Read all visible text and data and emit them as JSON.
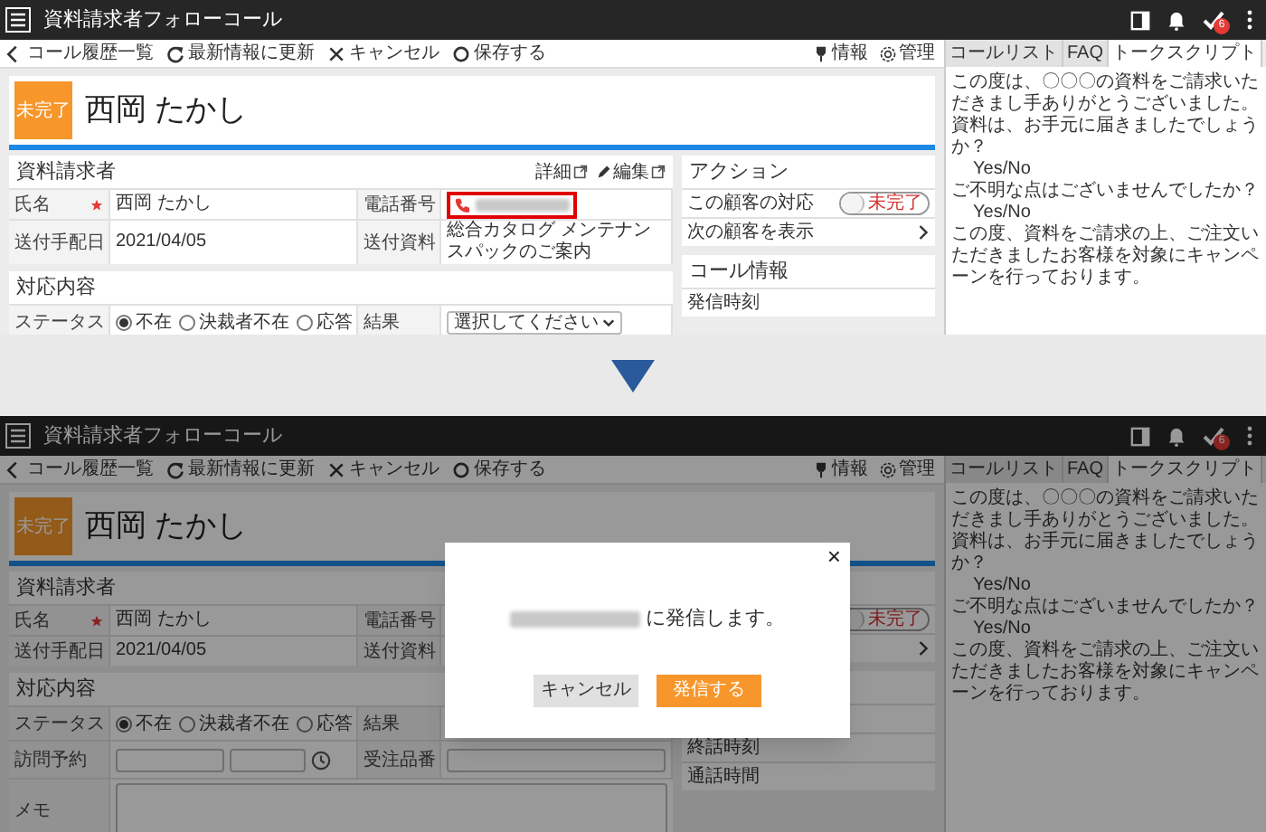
{
  "screens": [
    {
      "dimmed": false,
      "app_bar": {
        "title": "資料請求者フォローコール",
        "badge": "6"
      },
      "toolbar": [
        {
          "kind": "back",
          "label": "コール履歴一覧"
        },
        {
          "kind": "refresh",
          "label": "最新情報に更新"
        },
        {
          "kind": "cancel",
          "label": "キャンセル"
        },
        {
          "kind": "save",
          "label": "保存する"
        }
      ],
      "toolbar_links": [
        {
          "kind": "info",
          "label": "情報"
        },
        {
          "kind": "manage",
          "label": "管理"
        }
      ],
      "tabs": [
        {
          "label": "コールリスト",
          "selected": false
        },
        {
          "label": "FAQ",
          "selected": false
        },
        {
          "label": "トークスクリプト",
          "selected": true
        }
      ],
      "script": [
        {
          "text": "この度は、〇〇〇の資料をご請求いただきまし手ありがとうございました。",
          "indent": false
        },
        {
          "text": "資料は、お手元に届きましたでしょうか？",
          "indent": false
        },
        {
          "text": "Yes/No",
          "indent": true
        },
        {
          "text": "ご不明な点はございませんでしたか？",
          "indent": false
        },
        {
          "text": "Yes/No",
          "indent": true
        },
        {
          "text": "この度、資料をご請求の上、ご注文いただきましたお客様を対象にキャンペーンを行っております。",
          "indent": false
        }
      ],
      "header": {
        "status": "未完了",
        "name": "西岡 たかし"
      },
      "requester": {
        "title": "資料請求者",
        "links": [
          {
            "kind": "detail",
            "label": "詳細"
          },
          {
            "kind": "edit",
            "label": "編集"
          }
        ],
        "rows": [
          {
            "label": "氏名",
            "required": true,
            "value": "西岡 たかし",
            "label_2": "電話番号",
            "value_2": {
              "kind": "phone",
              "highlighted": true
            }
          },
          {
            "label": "送付手配日",
            "required": false,
            "value": "2021/04/05",
            "label_2": "送付資料",
            "value_2": {
              "kind": "text",
              "text": "総合カタログ メンテナンスパックのご案内"
            }
          }
        ]
      },
      "response": {
        "title": "対応内容",
        "rows": [
          {
            "kind": "status",
            "label": "ステータス",
            "options": [
              {
                "label": "不在",
                "selected": true
              },
              {
                "label": "決裁者不在",
                "selected": false
              },
              {
                "label": "応答",
                "selected": false
              }
            ],
            "label_2": "結果",
            "value_2": {
              "kind": "select",
              "text": "選択してください"
            }
          }
        ]
      },
      "action": {
        "title": "アクション",
        "rows": [
          {
            "kind": "toggle",
            "label": "この顧客の対応",
            "on": false,
            "state_label": "未完了"
          },
          {
            "kind": "link",
            "label": "次の顧客を表示"
          }
        ]
      },
      "call_info": {
        "title": "コール情報",
        "rows": [
          {
            "label": "発信時刻"
          }
        ]
      }
    },
    {
      "dimmed": true,
      "app_bar": {
        "title": "資料請求者フォローコール",
        "badge": "6"
      },
      "toolbar": [
        {
          "kind": "back",
          "label": "コール履歴一覧"
        },
        {
          "kind": "refresh",
          "label": "最新情報に更新"
        },
        {
          "kind": "cancel",
          "label": "キャンセル"
        },
        {
          "kind": "save",
          "label": "保存する"
        }
      ],
      "toolbar_links": [
        {
          "kind": "info",
          "label": "情報"
        },
        {
          "kind": "manage",
          "label": "管理"
        }
      ],
      "tabs": [
        {
          "label": "コールリスト",
          "selected": false
        },
        {
          "label": "FAQ",
          "selected": false
        },
        {
          "label": "トークスクリプト",
          "selected": true
        }
      ],
      "script": [
        {
          "text": "この度は、〇〇〇の資料をご請求いただきまし手ありがとうございました。",
          "indent": false
        },
        {
          "text": "資料は、お手元に届きましたでしょうか？",
          "indent": false
        },
        {
          "text": "Yes/No",
          "indent": true
        },
        {
          "text": "ご不明な点はございませんでしたか？",
          "indent": false
        },
        {
          "text": "Yes/No",
          "indent": true
        },
        {
          "text": "この度、資料をご請求の上、ご注文いただきましたお客様を対象にキャンペーンを行っております。",
          "indent": false
        }
      ],
      "header": {
        "status": "未完了",
        "name": "西岡 たかし"
      },
      "requester": {
        "title": "資料請求者",
        "rows": [
          {
            "label": "氏名",
            "required": true,
            "value": "西岡 たかし",
            "label_2": "電話番号"
          },
          {
            "label": "送付手配日",
            "required": false,
            "value": "2021/04/05",
            "label_2": "送付資料"
          }
        ]
      },
      "response": {
        "title": "対応内容",
        "rows": [
          {
            "kind": "status",
            "label": "ステータス",
            "options": [
              {
                "label": "不在",
                "selected": true
              },
              {
                "label": "決裁者不在",
                "selected": false
              },
              {
                "label": "応答",
                "selected": false
              }
            ],
            "label_2": "結果"
          },
          {
            "kind": "visit",
            "label": "訪問予約",
            "label_2": "受注品番",
            "value_2": {
              "kind": "input"
            }
          },
          {
            "kind": "memo",
            "label": "メモ"
          }
        ]
      },
      "action": {
        "rows": [
          {
            "kind": "toggle",
            "on": false,
            "state_label": "未完了"
          },
          {
            "kind": "link"
          }
        ]
      },
      "call_info": {
        "rows": [
          {},
          {
            "label": "終話時刻"
          },
          {
            "label": "通話時間"
          }
        ]
      },
      "modal": {
        "close": "×",
        "target": {
          "kind": "redacted"
        },
        "message": "に発信します。",
        "buttons": [
          {
            "kind": "secondary",
            "label": "キャンセル"
          },
          {
            "kind": "primary",
            "label": "発信する"
          }
        ]
      }
    }
  ]
}
